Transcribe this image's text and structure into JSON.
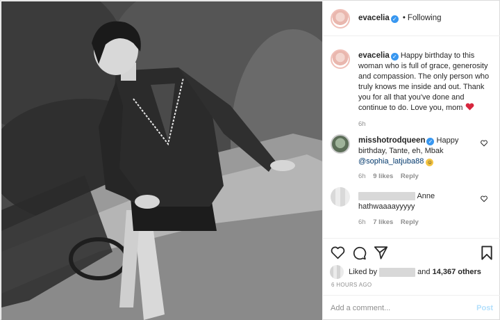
{
  "header": {
    "username": "evacelia",
    "separator": "•",
    "follow_status": "Following"
  },
  "caption": {
    "username": "evacelia",
    "text": "Happy birthday to this woman who is full of grace, generosity and compassion. The only person who truly knows me inside and out. Thank you for all that you've done and continue to do. Love you, mom",
    "time": "6h"
  },
  "comments": [
    {
      "username": "misshotrodqueen",
      "text": "Happy birthday, Tante, eh, Mbak",
      "mention": "@sophia_latjuba88",
      "time": "6h",
      "likes": "9 likes",
      "reply": "Reply"
    },
    {
      "username": "",
      "text": "Anne hathwaaaayyyyy",
      "time": "6h",
      "likes": "7 likes",
      "reply": "Reply"
    }
  ],
  "likes": {
    "prefix": "Liked by",
    "middle": "and",
    "others": "14,367 others"
  },
  "timestamp": "6 HOURS AGO",
  "add_comment": {
    "placeholder": "Add a comment...",
    "post_label": "Post"
  },
  "icons": [
    "heart-icon",
    "comment-icon",
    "share-icon",
    "bookmark-icon",
    "verified-icon",
    "red-heart-emoji",
    "emoji-face"
  ],
  "colors": {
    "verified": "#3897f0",
    "link": "#00376b",
    "muted": "#8e8e8e",
    "post_disabled": "#b2dffc",
    "heart": "#d7263d"
  }
}
